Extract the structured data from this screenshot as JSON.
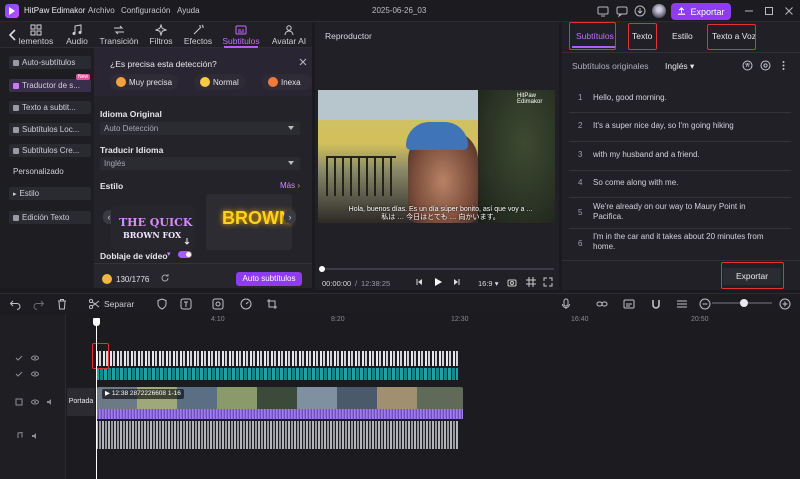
{
  "app": {
    "name": "HitPaw Edimakor",
    "menus": [
      "Archivo",
      "Configuración",
      "Ayuda"
    ],
    "project_name": "2025-06-26_03",
    "export_label": "Exportar"
  },
  "colors": {
    "accent": "#8e3cf0",
    "highlight": "#e2332f",
    "bg": "#1a1a1f"
  },
  "top_tabs": [
    {
      "label": "lementos",
      "icon": "elements-icon"
    },
    {
      "label": "Audio",
      "icon": "music-icon"
    },
    {
      "label": "Transición",
      "icon": "transition-icon"
    },
    {
      "label": "Filtros",
      "icon": "filter-icon"
    },
    {
      "label": "Efectos",
      "icon": "effects-icon"
    },
    {
      "label": "Subtitulos",
      "icon": "subtitle-icon",
      "active": true
    },
    {
      "label": "Avatar AI",
      "icon": "avatar-icon"
    }
  ],
  "sidebar": {
    "items": [
      {
        "label": "Auto-subtítulos"
      },
      {
        "label": "Traductor de s...",
        "active": true,
        "badge": "New"
      },
      {
        "label": "Texto a subtit..."
      },
      {
        "label": "Subtítulos Loc..."
      },
      {
        "label": "Subtítulos Cre..."
      },
      {
        "label": "Personalizado"
      },
      {
        "label": "Estilo"
      },
      {
        "label": "Edición Texto"
      }
    ]
  },
  "panel": {
    "precision_question": "¿Es precisa esta detección?",
    "precision_options": [
      "Muy precisa",
      "Normal",
      "Inexa"
    ],
    "idioma_original_label": "Idioma Original",
    "idioma_original_value": "Auto Detección",
    "traducir_label": "Traducir Idioma",
    "traducir_value": "Inglés",
    "estilo_label": "Estilo",
    "mas_label": "Más",
    "style1_text": [
      "THE QUICK",
      "BROWN FOX"
    ],
    "style2_text": "BROWN",
    "doblaje_label": "Doblaje de vídeo",
    "credits": "130/1776",
    "auto_button": "Auto subtítulos"
  },
  "player": {
    "title": "Reproductor",
    "subtitle_overlay": "Hola, buenos días. Es un día súper bonito, así que voy a ... 私は … 今日はとても … 向かいます。",
    "watermark": "HitPaw Edimakor",
    "time_current": "00:00:00",
    "time_total": "12:38:25",
    "aspect": "16:9",
    "progress": 0.0
  },
  "right_panel": {
    "tabs": [
      "Subtítulos",
      "Texto",
      "Estilo",
      "Texto a Voz"
    ],
    "original_label": "Subtítulos originales",
    "language": "Inglés",
    "rows": [
      {
        "num": "1",
        "text": "Hello, good morning."
      },
      {
        "num": "2",
        "text": "It's a super nice day, so I'm going hiking"
      },
      {
        "num": "3",
        "text": "with my husband and a friend."
      },
      {
        "num": "4",
        "text": "So come along with me."
      },
      {
        "num": "5",
        "text": "We're already on our way to Maury Point in Pacifica."
      },
      {
        "num": "6",
        "text": "I'm in the car and it takes about 20 minutes from home."
      }
    ],
    "export_button": "Exportar"
  },
  "toolbar": {
    "split_label": "Separar"
  },
  "timeline": {
    "ticks": [
      "4:10",
      "8:20",
      "12:30",
      "16:40",
      "20:50"
    ],
    "cover_label": "Portada",
    "clip_label": "12:38 2872226608 1-16"
  }
}
